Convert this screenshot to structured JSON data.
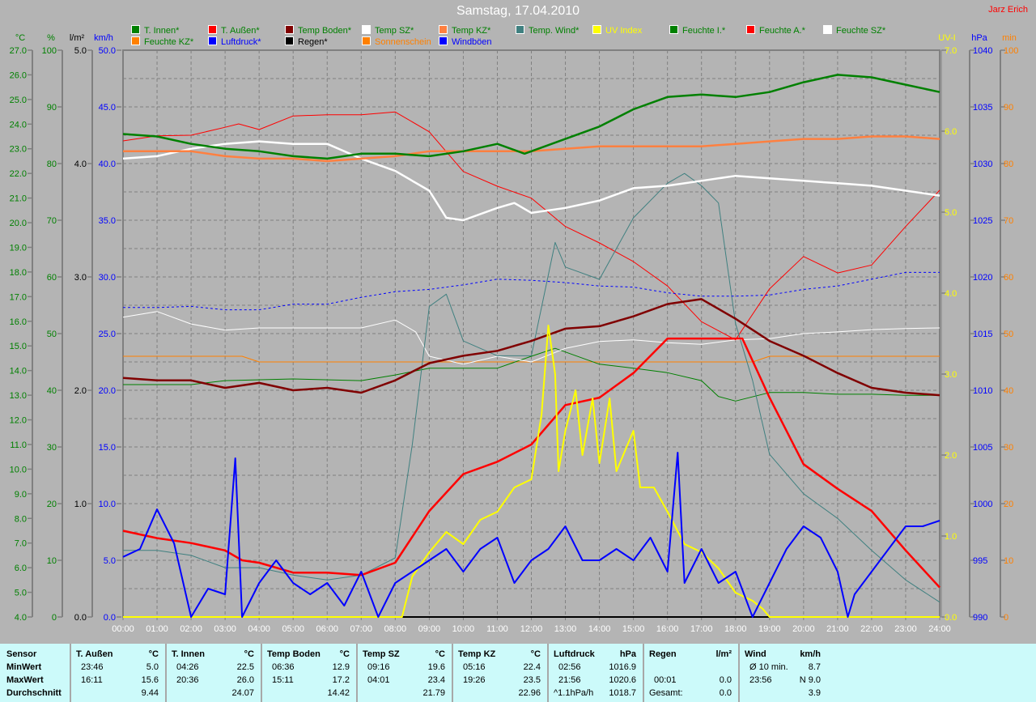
{
  "title": "Samstag, 17.04.2010",
  "author": "Jarz Erich",
  "legend": [
    {
      "label": "T. Innen*",
      "swatch": "#008000",
      "text_color": "#008000"
    },
    {
      "label": "T. Außen*",
      "swatch": "#ff0000",
      "text_color": "#008000"
    },
    {
      "label": "Temp Boden*",
      "swatch": "#800000",
      "text_color": "#008000"
    },
    {
      "label": "Temp SZ*",
      "swatch": "#ffffff",
      "text_color": "#008000"
    },
    {
      "label": "Temp KZ*",
      "swatch": "#ff8040",
      "text_color": "#008000"
    },
    {
      "label": "Temp. Wind*",
      "swatch": "#408080",
      "text_color": "#008000"
    },
    {
      "label": "UV Index",
      "swatch": "#ffff00",
      "text_color": "#ffff00"
    },
    {
      "label": "Feuchte I.*",
      "swatch": "#008000",
      "text_color": "#008000"
    },
    {
      "label": "Feuchte A.*",
      "swatch": "#ff0000",
      "text_color": "#008000"
    },
    {
      "label": "Feuchte SZ*",
      "swatch": "#ffffff",
      "text_color": "#008000"
    },
    {
      "label": "Feuchte KZ*",
      "swatch": "#ff8000",
      "text_color": "#008000"
    },
    {
      "label": "Luftdruck*",
      "swatch": "#0000ff",
      "text_color": "#0000ff"
    },
    {
      "label": "Regen*",
      "swatch": "#000000",
      "text_color": "#000000"
    },
    {
      "label": "Sonnenschein",
      "swatch": "#ff8000",
      "text_color": "#ff8000"
    },
    {
      "label": "Windböen",
      "swatch": "#0000ff",
      "text_color": "#0000ff"
    }
  ],
  "chart_data": {
    "type": "line",
    "title": "Samstag, 17.04.2010",
    "xlabel": "",
    "x_ticks": [
      "00:00",
      "01:00",
      "02:00",
      "03:00",
      "04:00",
      "05:00",
      "06:00",
      "07:00",
      "08:00",
      "09:00",
      "10:00",
      "11:00",
      "12:00",
      "13:00",
      "14:00",
      "15:00",
      "16:00",
      "17:00",
      "18:00",
      "19:00",
      "20:00",
      "21:00",
      "22:00",
      "23:00",
      "24:00"
    ],
    "xlim": [
      0,
      24
    ],
    "grid": true,
    "legend_placement": "top",
    "axes": {
      "temp": {
        "unit": "°C",
        "range": [
          4,
          27
        ],
        "ticks": [
          "4.0",
          "5.0",
          "6.0",
          "7.0",
          "8.0",
          "9.0",
          "10.0",
          "11.0",
          "12.0",
          "13.0",
          "14.0",
          "15.0",
          "16.0",
          "17.0",
          "18.0",
          "19.0",
          "20.0",
          "21.0",
          "22.0",
          "23.0",
          "24.0",
          "25.0",
          "26.0",
          "27.0"
        ],
        "color": "#008000",
        "side": "left"
      },
      "hum": {
        "unit": "%",
        "range": [
          0,
          100
        ],
        "ticks": [
          "0",
          "10",
          "20",
          "30",
          "40",
          "50",
          "60",
          "70",
          "80",
          "90",
          "100"
        ],
        "color": "#008000",
        "side": "left"
      },
      "rain": {
        "unit": "l/m²",
        "range": [
          0,
          5
        ],
        "ticks": [
          "0.0",
          "1.0",
          "2.0",
          "3.0",
          "4.0",
          "5.0"
        ],
        "color": "#000000",
        "side": "left"
      },
      "kmh": {
        "unit": "km/h",
        "range": [
          0,
          50
        ],
        "ticks": [
          "0.0",
          "5.0",
          "10.0",
          "15.0",
          "20.0",
          "25.0",
          "30.0",
          "35.0",
          "40.0",
          "45.0",
          "50.0"
        ],
        "color": "#0000ff",
        "side": "left"
      },
      "uv": {
        "unit": "UV-I",
        "range": [
          0,
          7
        ],
        "ticks": [
          "0.0",
          "1.0",
          "2.0",
          "3.0",
          "4.0",
          "5.0",
          "6.0",
          "7.0"
        ],
        "color": "#ffff00",
        "side": "right"
      },
      "hpa": {
        "unit": "hPa",
        "range": [
          990,
          1040
        ],
        "ticks": [
          "990",
          "995",
          "1000",
          "1005",
          "1010",
          "1015",
          "1020",
          "1025",
          "1030",
          "1035",
          "1040"
        ],
        "color": "#0000ff",
        "side": "right"
      },
      "min": {
        "unit": "min",
        "range": [
          0,
          100
        ],
        "ticks": [
          "0",
          "10",
          "20",
          "30",
          "40",
          "50",
          "60",
          "70",
          "80",
          "90",
          "100"
        ],
        "color": "#ff8000",
        "side": "right"
      }
    },
    "series": [
      {
        "name": "Regen*",
        "axis": "rain",
        "color": "#000000",
        "width": 2,
        "x": [
          0,
          24
        ],
        "y": [
          0,
          0
        ]
      },
      {
        "name": "Feuchte KZ*",
        "axis": "hum",
        "color": "#ff8000",
        "width": 1,
        "x": [
          0,
          3.5,
          4,
          18.5,
          19,
          24
        ],
        "y": [
          46,
          46,
          45,
          45,
          46,
          46
        ]
      },
      {
        "name": "Feuchte I.*",
        "axis": "hum",
        "color": "#008000",
        "width": 1,
        "x": [
          0,
          2,
          3,
          5,
          7,
          8,
          9,
          10,
          11,
          12,
          12.7,
          14,
          15,
          16,
          17,
          17.5,
          18,
          19,
          20,
          21,
          22,
          23,
          24
        ],
        "y": [
          41,
          41,
          41.7,
          42,
          41.7,
          42.7,
          43.9,
          43.9,
          43.9,
          46,
          47.4,
          44.6,
          43.9,
          43.1,
          41.7,
          38.9,
          38.1,
          39.6,
          39.6,
          39.3,
          39.3,
          39.1,
          39.1
        ]
      },
      {
        "name": "Feuchte SZ*",
        "axis": "hum",
        "color": "#ffffff",
        "width": 1,
        "x": [
          0,
          1,
          2,
          3,
          4,
          5,
          6,
          7,
          8,
          8.6,
          9,
          10,
          11,
          12,
          13,
          14,
          15,
          16,
          17,
          18,
          19,
          20,
          21,
          22,
          23,
          24
        ],
        "y": [
          52.9,
          53.9,
          51.7,
          50.6,
          51,
          51,
          51,
          51,
          52.4,
          50.3,
          46,
          44.6,
          46,
          45,
          47.4,
          48.6,
          48.9,
          48.4,
          48.1,
          48.9,
          49.1,
          50,
          50.3,
          50.7,
          50.9,
          51
        ]
      },
      {
        "name": "Feuchte A.*",
        "axis": "hum",
        "color": "#ff0000",
        "width": 1,
        "x": [
          0,
          1,
          2,
          3,
          3.4,
          4,
          5,
          6,
          7,
          8,
          9,
          10,
          11,
          12,
          13,
          14,
          15,
          16,
          17,
          18,
          19,
          20,
          21,
          22,
          23,
          24
        ],
        "y": [
          84,
          84.9,
          85,
          86.4,
          87,
          86,
          88.4,
          88.6,
          88.6,
          89.1,
          85.6,
          78.6,
          76,
          73.9,
          68.9,
          66,
          62.7,
          58.4,
          52.1,
          48.9,
          57.9,
          63.6,
          60.7,
          62.1,
          68.9,
          75.3
        ]
      },
      {
        "name": "Temp. Wind*",
        "axis": "temp",
        "color": "#408080",
        "width": 1,
        "x": [
          0,
          1,
          2,
          3,
          4,
          5,
          6,
          7,
          8,
          8.5,
          9,
          9.5,
          10,
          11,
          12,
          12.7,
          13,
          14,
          15,
          16,
          16.5,
          17,
          17.5,
          18,
          18.5,
          19,
          20,
          21,
          22,
          23,
          24
        ],
        "y": [
          6.7,
          6.7,
          6.5,
          6.0,
          6.0,
          5.7,
          5.5,
          5.7,
          6.4,
          11.0,
          16.6,
          17.1,
          15.2,
          14.6,
          14.6,
          19.2,
          18.2,
          17.7,
          20.2,
          21.6,
          22.0,
          21.5,
          20.8,
          15.9,
          13.6,
          10.6,
          9.0,
          8.0,
          6.7,
          5.5,
          4.6
        ]
      },
      {
        "name": "Luftdruck*",
        "axis": "hpa",
        "color": "#0000ff",
        "width": 1,
        "dash": "3,3",
        "x": [
          0,
          1,
          2,
          3,
          4,
          5,
          6,
          7,
          8,
          9,
          10,
          11,
          12,
          13,
          14,
          15,
          16,
          17,
          18,
          19,
          20,
          21,
          22,
          23,
          24
        ],
        "y": [
          1017.3,
          1017.3,
          1017.4,
          1017.1,
          1017.1,
          1017.6,
          1017.6,
          1018.2,
          1018.7,
          1018.9,
          1019.3,
          1019.8,
          1019.7,
          1019.5,
          1019.2,
          1019.1,
          1018.6,
          1018.3,
          1018.3,
          1018.4,
          1018.9,
          1019.2,
          1019.8,
          1020.4,
          1020.4
        ]
      },
      {
        "name": "Temp Boden*",
        "axis": "temp",
        "color": "#800000",
        "width": 2.5,
        "x": [
          0,
          1,
          2,
          3,
          4,
          5,
          6,
          7,
          8,
          9,
          10,
          11,
          12,
          13,
          14,
          15,
          16,
          17,
          18,
          19,
          20,
          21,
          22,
          23,
          24
        ],
        "y": [
          13.7,
          13.6,
          13.6,
          13.3,
          13.5,
          13.2,
          13.3,
          13.1,
          13.6,
          14.3,
          14.6,
          14.8,
          15.2,
          15.7,
          15.8,
          16.2,
          16.7,
          16.9,
          16.1,
          15.2,
          14.6,
          13.9,
          13.3,
          13.1,
          13.0
        ]
      },
      {
        "name": "T. Außen*",
        "axis": "temp",
        "color": "#ff0000",
        "width": 2.5,
        "x": [
          0,
          1,
          2,
          3,
          3.5,
          4,
          5,
          6,
          7,
          8,
          9,
          10,
          11,
          12,
          13,
          14,
          15,
          16,
          17,
          18.2,
          19,
          20,
          21,
          22,
          23,
          24
        ],
        "y": [
          7.5,
          7.2,
          7.0,
          6.7,
          6.3,
          6.2,
          5.8,
          5.8,
          5.7,
          6.2,
          8.3,
          9.8,
          10.3,
          11.0,
          12.6,
          12.9,
          13.9,
          15.3,
          15.3,
          15.3,
          12.9,
          10.2,
          9.2,
          8.3,
          6.7,
          5.2
        ]
      },
      {
        "name": "Temp SZ*",
        "axis": "temp",
        "color": "#ffffff",
        "width": 2.5,
        "x": [
          0,
          1,
          2,
          3,
          4,
          5,
          6,
          7,
          8,
          9,
          9.5,
          10,
          11,
          11.5,
          12,
          13,
          14,
          15,
          16,
          17,
          18,
          19,
          20,
          21,
          22,
          23,
          24
        ],
        "y": [
          22.6,
          22.7,
          23.0,
          23.2,
          23.3,
          23.2,
          23.2,
          22.6,
          22.1,
          21.3,
          20.2,
          20.1,
          20.6,
          20.8,
          20.4,
          20.6,
          20.9,
          21.4,
          21.5,
          21.7,
          21.9,
          21.8,
          21.7,
          21.6,
          21.5,
          21.3,
          21.1
        ]
      },
      {
        "name": "Temp KZ*",
        "axis": "temp",
        "color": "#ff8040",
        "width": 2.5,
        "x": [
          0,
          1,
          2,
          3,
          4,
          5,
          6,
          7,
          8,
          9,
          10,
          11,
          12,
          13,
          14,
          15,
          16,
          17,
          18,
          19,
          20,
          21,
          22,
          23,
          24
        ],
        "y": [
          22.9,
          22.9,
          22.9,
          22.7,
          22.6,
          22.6,
          22.5,
          22.6,
          22.7,
          22.9,
          22.9,
          22.9,
          22.9,
          23.0,
          23.1,
          23.1,
          23.1,
          23.1,
          23.2,
          23.3,
          23.4,
          23.4,
          23.5,
          23.5,
          23.4
        ]
      },
      {
        "name": "T. Innen*",
        "axis": "temp",
        "color": "#008000",
        "width": 2.5,
        "x": [
          0,
          1,
          2,
          3,
          4,
          5,
          6,
          7,
          8,
          9,
          10,
          11,
          11.8,
          12,
          13,
          14,
          15,
          16,
          17,
          18,
          19,
          20,
          21,
          22,
          23,
          24
        ],
        "y": [
          23.6,
          23.5,
          23.2,
          23.0,
          22.9,
          22.7,
          22.6,
          22.8,
          22.8,
          22.7,
          22.9,
          23.2,
          22.8,
          22.9,
          23.4,
          23.9,
          24.6,
          25.1,
          25.2,
          25.1,
          25.3,
          25.7,
          26.0,
          25.9,
          25.6,
          25.3
        ]
      },
      {
        "name": "UV Index",
        "axis": "uv",
        "color": "#ffff00",
        "width": 2,
        "x": [
          0,
          8.2,
          8.5,
          9,
          9.5,
          10,
          10.5,
          11,
          11.5,
          12,
          12.3,
          12.5,
          12.7,
          12.8,
          13,
          13.3,
          13.5,
          13.8,
          14,
          14.3,
          14.5,
          15,
          15.2,
          15.6,
          16,
          16.5,
          17,
          17.5,
          18,
          18.5,
          18.8,
          19,
          24
        ],
        "y": [
          0,
          0,
          0.5,
          0.8,
          1.05,
          0.9,
          1.2,
          1.3,
          1.6,
          1.7,
          2.5,
          3.6,
          3.0,
          1.8,
          2.3,
          2.8,
          2.0,
          2.7,
          1.9,
          2.7,
          1.8,
          2.3,
          1.6,
          1.6,
          1.3,
          0.9,
          0.8,
          0.6,
          0.3,
          0.2,
          0.1,
          0,
          0
        ]
      },
      {
        "name": "Windböen",
        "axis": "kmh",
        "color": "#0000ff",
        "width": 2,
        "x": [
          0,
          0.5,
          1,
          1.5,
          2,
          2.5,
          3,
          3.3,
          3.5,
          4,
          4.5,
          5,
          5.5,
          6,
          6.5,
          7,
          7.5,
          8,
          8.5,
          9,
          9.5,
          10,
          10.5,
          11,
          11.5,
          12,
          12.5,
          13,
          13.5,
          14,
          14.5,
          15,
          15.5,
          16,
          16.3,
          16.5,
          17,
          17.5,
          18,
          18.5,
          19,
          19.5,
          20,
          20.5,
          21,
          21.3,
          21.5,
          22,
          22.5,
          23,
          23.5,
          24
        ],
        "y": [
          5.3,
          6,
          9.5,
          6.5,
          0,
          2.5,
          2,
          14,
          0,
          3,
          5,
          3,
          2,
          3,
          1,
          4,
          0,
          3,
          4,
          5,
          6,
          4,
          6,
          7,
          3,
          5,
          6,
          8,
          5,
          5,
          6,
          5,
          7,
          4,
          14.5,
          3,
          6,
          3,
          4,
          0,
          3,
          6,
          8,
          7,
          4,
          0,
          2,
          4,
          6,
          8,
          8,
          8.5
        ]
      }
    ]
  },
  "stats": {
    "row_labels": [
      "Sensor",
      "MinWert",
      "MaxWert",
      "Durchschnitt"
    ],
    "columns": [
      {
        "name": "T. Außen",
        "unit": "°C",
        "min_time": "23:46",
        "min": "5.0",
        "max_time": "16:11",
        "max": "15.6",
        "avg_label": "",
        "avg": "9.44"
      },
      {
        "name": "T. Innen",
        "unit": "°C",
        "min_time": "04:26",
        "min": "22.5",
        "max_time": "20:36",
        "max": "26.0",
        "avg_label": "",
        "avg": "24.07"
      },
      {
        "name": "Temp Boden",
        "unit": "°C",
        "min_time": "06:36",
        "min": "12.9",
        "max_time": "15:11",
        "max": "17.2",
        "avg_label": "",
        "avg": "14.42"
      },
      {
        "name": "Temp SZ",
        "unit": "°C",
        "min_time": "09:16",
        "min": "19.6",
        "max_time": "04:01",
        "max": "23.4",
        "avg_label": "",
        "avg": "21.79"
      },
      {
        "name": "Temp KZ",
        "unit": "°C",
        "min_time": "05:16",
        "min": "22.4",
        "max_time": "19:26",
        "max": "23.5",
        "avg_label": "",
        "avg": "22.96"
      },
      {
        "name": "Luftdruck",
        "unit": "hPa",
        "min_time": "02:56",
        "min": "1016.9",
        "max_time": "21:56",
        "max": "1020.6",
        "avg_label": "^1.1hPa/h",
        "avg": "1018.7"
      },
      {
        "name": "Regen",
        "unit": "l/m²",
        "min_time": "",
        "min": "",
        "max_time": "00:01",
        "max": "0.0",
        "avg_label": "Gesamt:",
        "avg": "0.0"
      },
      {
        "name": "Wind",
        "unit": "km/h",
        "min_time": "Ø 10 min.",
        "min": "8.7",
        "max_time": "23:56",
        "max": "N 9.0",
        "avg_label": "",
        "avg": "3.9"
      }
    ]
  }
}
